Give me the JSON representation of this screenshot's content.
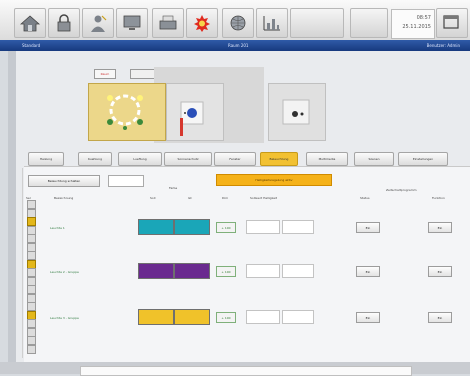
{
  "toolbar": {
    "icons": [
      "home-icon",
      "lock-icon",
      "person-icon",
      "display-icon",
      "printer-icon",
      "alarm-icon",
      "globe-icon",
      "chart-icon"
    ],
    "clock_time": "08:57",
    "clock_date": "25.11.2015"
  },
  "header": {
    "left_label": "Standard",
    "center_label": "Raum 201",
    "right_label": "Benutzer: Admin"
  },
  "room_tabs": [
    "Raum",
    "Raumbeschreibung"
  ],
  "tabs": [
    "Heizung",
    "Kuehlung",
    "Lueftung",
    "Sonnenschutz",
    "Fenster",
    "Beleuchtung",
    "Multimedia",
    "Szenen",
    "Einstellungen"
  ],
  "active_tab": 5,
  "content": {
    "action_button": "Beleuchtung schalten",
    "banner": "Helligkeitsregelung aktiv",
    "columns": {
      "sel": "Sel",
      "name": "Bezeichnung",
      "color_group": "Farbe",
      "color_soll": "Soll",
      "color_ist": "Ist",
      "dim": "Dim",
      "value": "Sollwert Helligkeit",
      "status": "Status",
      "schedule": "Zeitschaltprogramm",
      "function": "Funktion"
    },
    "rows": [
      {
        "name": "Leuchte 1",
        "color": "#1aa6b8",
        "value_btn": "+ 100",
        "status_btn": "Ein",
        "func_btn": "Ein"
      },
      {
        "name": "Leuchte 2 - Gruppe",
        "color": "#6a2a8f",
        "value_btn": "+ 100",
        "status_btn": "Ein",
        "func_btn": "Ein"
      },
      {
        "name": "Leuchte 3 - Gruppe",
        "color": "#f0c22a",
        "value_btn": "+ 100",
        "status_btn": "Ein",
        "func_btn": "Ein"
      }
    ],
    "row_checks": [
      false,
      false,
      true,
      false,
      false,
      false,
      false,
      true,
      false,
      false,
      false,
      false,
      false,
      true,
      false,
      false,
      false,
      false
    ]
  },
  "colors": {
    "header_blue": "#1f4690",
    "active_tab": "#f2c132",
    "banner": "#f5b21a"
  }
}
